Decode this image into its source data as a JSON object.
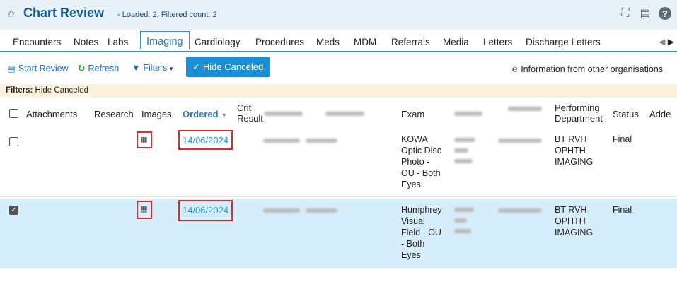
{
  "header": {
    "title": "Chart Review",
    "subtitle": "- Loaded: 2, Filtered count: 2"
  },
  "tabs": [
    "Encounters",
    "Notes",
    "Labs",
    "Imaging",
    "Cardiology",
    "Procedures",
    "Meds",
    "MDM",
    "Referrals",
    "Media",
    "Letters",
    "Discharge Letters"
  ],
  "toolbar": {
    "start_review": "Start Review",
    "refresh": "Refresh",
    "filters": "Filters",
    "hide_canceled": "Hide Canceled",
    "info": "Information from other organisations"
  },
  "filters_bar": {
    "label": "Filters:",
    "value": "Hide Canceled"
  },
  "columns": {
    "attachments": "Attachments",
    "research": "Research",
    "images": "Images",
    "ordered": "Ordered",
    "crit_result_1": "Crit",
    "crit_result_2": "Result",
    "exam": "Exam",
    "perf_dept_1": "Performing",
    "perf_dept_2": "Department",
    "status": "Status",
    "addendum": "Adde"
  },
  "rows": [
    {
      "checked": false,
      "ordered": "14/06/2024",
      "exam": [
        "KOWA",
        "Optic Disc",
        "Photo -",
        "OU - Both",
        "Eyes"
      ],
      "department": [
        "BT RVH",
        "OPHTH",
        "IMAGING"
      ],
      "status": "Final"
    },
    {
      "checked": true,
      "ordered": "14/06/2024",
      "exam": [
        "Humphrey",
        "Visual",
        "Field - OU",
        "- Both",
        "Eyes"
      ],
      "department": [
        "BT RVH",
        "OPHTH",
        "IMAGING"
      ],
      "status": "Final"
    }
  ],
  "colors": {
    "accent": "#2a7ab9",
    "button": "#1890d8",
    "selected_row": "#d6eefb",
    "highlight": "#d32f2f"
  }
}
